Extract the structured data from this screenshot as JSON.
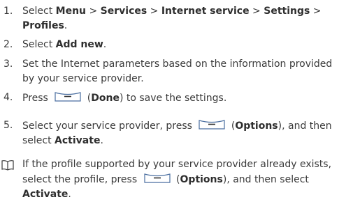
{
  "steps": [
    {
      "num": "1.",
      "pre": "Select ",
      "path": [
        {
          "label": "Menu"
        },
        {
          "sep": " > ",
          "label": "Services"
        },
        {
          "sep": " > ",
          "label": "Internet service"
        },
        {
          "sep": " > ",
          "label": "Settings"
        },
        {
          "sep": " > ",
          "label": "Profiles"
        }
      ],
      "post": "."
    },
    {
      "num": "2.",
      "pre": "Select ",
      "bold": "Add new",
      "post": "."
    },
    {
      "num": "3.",
      "text": "Set the Internet parameters based on the information provided by your service provider."
    },
    {
      "num": "4.",
      "pre": "Press",
      "paren_open": "(",
      "bold": "Done",
      "post": ") to save the settings."
    },
    {
      "num": "5.",
      "pre": "Select your service provider, press",
      "paren_open": "(",
      "bold": "Options",
      "mid": "), and then select ",
      "bold2": "Activate",
      "post": "."
    }
  ],
  "note": {
    "icon": "book-icon",
    "pre": "If the profile supported by your service provider already exists, select the profile, press",
    "paren_open": "(",
    "bold": "Options",
    "mid": "), and then select ",
    "bold2": "Activate",
    "post": "."
  },
  "icons": {
    "soft_key": "left-soft-key-icon"
  },
  "colors": {
    "text": "#3a3a3a",
    "icon_stroke": "#4a6ea0"
  }
}
